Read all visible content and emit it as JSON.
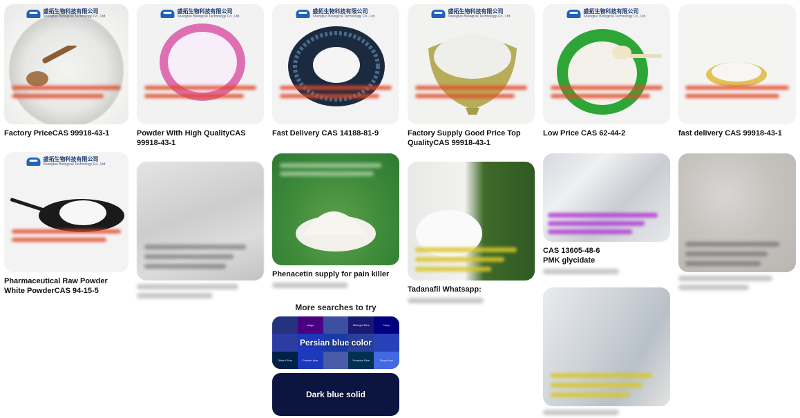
{
  "brand": {
    "name": "盛拓生物科技有限公司",
    "subtitle": "Shengtuo Biological Technology Co., Ltd."
  },
  "pins": [
    {
      "id": "pin-1",
      "title": "Factory PriceCAS 99918-43-1"
    },
    {
      "id": "pin-2",
      "title": "Powder With High QualityCAS 99918-43-1"
    },
    {
      "id": "pin-3",
      "title": "Fast Delivery CAS 14188-81-9"
    },
    {
      "id": "pin-4",
      "title": "Factory Supply Good Price Top QualityCAS 99918-43-1"
    },
    {
      "id": "pin-5",
      "title": "Low Price CAS 62-44-2"
    },
    {
      "id": "pin-6",
      "title": "fast delivery CAS 99918-43-1"
    },
    {
      "id": "pin-7",
      "title": "Pharmaceutical Raw Powder White PowderCAS 94-15-5"
    },
    {
      "id": "pin-8",
      "title": ""
    },
    {
      "id": "pin-9",
      "title": "Phenacetin supply for pain killer"
    },
    {
      "id": "pin-10",
      "title": "Tadanafil Whatsapp:"
    },
    {
      "id": "pin-11",
      "title": "CAS 13605-48-6",
      "subtitle": "PMK glycidate"
    },
    {
      "id": "pin-12",
      "title": ""
    }
  ],
  "more_searches": {
    "title": "More searches to try",
    "items": [
      {
        "label": "Persian blue color",
        "swatches": [
          "Indigo",
          "Midnight Blue",
          "Navy",
          "Oxford Blue",
          "Persian blue",
          "Prussian Blue",
          "Royal blue"
        ]
      },
      {
        "label": "Dark blue solid"
      }
    ]
  },
  "colors": {
    "logo_blue": "#1e63b8",
    "contact_red": "#e24a2a",
    "contact_purple": "#b33cd6",
    "contact_yellow": "#d9c62a",
    "tile_dark_blue": "#0c1440"
  }
}
